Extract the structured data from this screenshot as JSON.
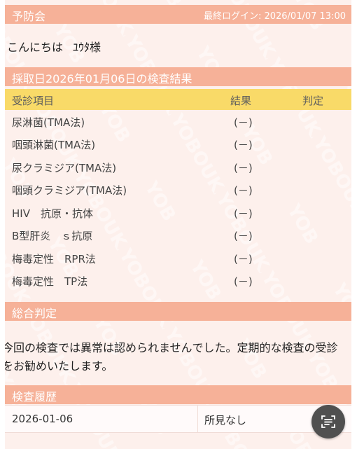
{
  "header": {
    "brand": "予防会",
    "last_login": "最終ログイン: 2026/01/07 13:00"
  },
  "greeting": {
    "hello": "こんにちは",
    "name": "ﾕｳﾀ様"
  },
  "watermark_text": "YOBOUKAI",
  "results_section": {
    "title": "採取日2026年01月06日の検査結果",
    "columns": [
      "受診項目",
      "結果",
      "判定"
    ],
    "rows": [
      {
        "item": "尿淋菌(TMA法)",
        "result": "(－)",
        "judgement": ""
      },
      {
        "item": "咽頭淋菌(TMA法)",
        "result": "(－)",
        "judgement": ""
      },
      {
        "item": "尿クラミジア(TMA法)",
        "result": "(－)",
        "judgement": ""
      },
      {
        "item": "咽頭クラミジア(TMA法)",
        "result": "(－)",
        "judgement": ""
      },
      {
        "item": "HIV　抗原・抗体",
        "result": "(－)",
        "judgement": ""
      },
      {
        "item": "B型肝炎　ｓ抗原",
        "result": "(－)",
        "judgement": ""
      },
      {
        "item": "梅毒定性　RPR法",
        "result": "(－)",
        "judgement": ""
      },
      {
        "item": "梅毒定性　TP法",
        "result": "(－)",
        "judgement": ""
      }
    ]
  },
  "summary_section": {
    "title": "総合判定",
    "text": "今回の検査では異常は認められませんでした。定期的な検査の受診をお勧めいたします。"
  },
  "history_section": {
    "title": "検査履歴",
    "rows": [
      {
        "date": "2026-01-06",
        "finding": "所見なし"
      }
    ]
  },
  "colors": {
    "header_bar": "#f6b198",
    "table_header": "#f9da68",
    "panel_bg": "#fdf0ec"
  },
  "floating_button": {
    "icon": "scan-text-icon"
  }
}
